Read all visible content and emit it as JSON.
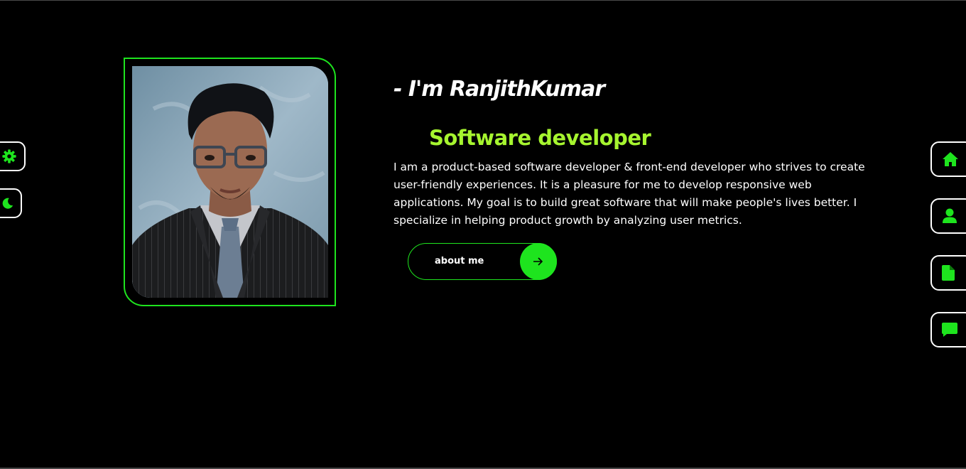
{
  "hero": {
    "intro": "- I'm RanjithKumar",
    "role": "Software developer",
    "bio": "I am a product-based software developer & front-end developer who strives to create user-friendly experiences. It is a pleasure for me to develop responsive web applications. My goal is to build great software that will make people's lives better. I specialize in helping product growth by analyzing user metrics.",
    "button_label": "about me"
  },
  "left_controls": {
    "icons": [
      "gear-icon",
      "moon-icon"
    ]
  },
  "right_nav": {
    "icons": [
      "home-icon",
      "user-icon",
      "document-icon",
      "chat-icon"
    ]
  },
  "colors": {
    "accent": "#1EE41E",
    "role_text": "#A6F52F",
    "background": "#000000",
    "text": "#FFFFFF"
  }
}
